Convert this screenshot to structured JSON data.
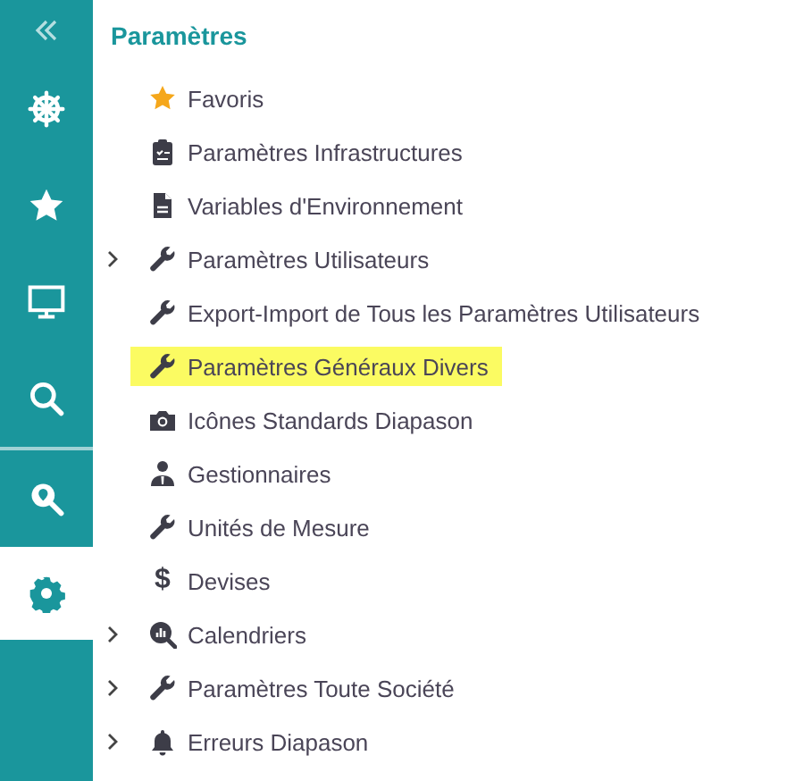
{
  "sidebar": {
    "items": [
      {
        "kind": "wheel",
        "selected": false
      },
      {
        "kind": "star",
        "selected": false
      },
      {
        "kind": "monitor",
        "selected": false
      },
      {
        "kind": "search",
        "selected": false
      },
      {
        "kind": "search-pin",
        "selected": false
      },
      {
        "kind": "gear",
        "selected": true
      }
    ]
  },
  "panel": {
    "title": "Paramètres",
    "items": [
      {
        "label": "Favoris",
        "kind": "star",
        "expandable": false,
        "selected": false
      },
      {
        "label": "Paramètres Infrastructures",
        "kind": "clipboard",
        "expandable": false,
        "selected": false
      },
      {
        "label": "Variables d'Environnement",
        "kind": "file",
        "expandable": false,
        "selected": false
      },
      {
        "label": "Paramètres Utilisateurs",
        "kind": "wrench",
        "expandable": true,
        "selected": false
      },
      {
        "label": "Export-Import de Tous les Paramètres Utilisateurs",
        "kind": "wrench",
        "expandable": false,
        "selected": false
      },
      {
        "label": "Paramètres Généraux Divers",
        "kind": "wrench",
        "expandable": false,
        "selected": true
      },
      {
        "label": "Icônes Standards Diapason",
        "kind": "camera",
        "expandable": false,
        "selected": false
      },
      {
        "label": "Gestionnaires",
        "kind": "person",
        "expandable": false,
        "selected": false
      },
      {
        "label": "Unités de Mesure",
        "kind": "wrench",
        "expandable": false,
        "selected": false
      },
      {
        "label": "Devises",
        "kind": "glyph",
        "glyph": "$",
        "expandable": false,
        "selected": false
      },
      {
        "label": "Calendriers",
        "kind": "chart",
        "expandable": true,
        "selected": false
      },
      {
        "label": "Paramètres Toute Société",
        "kind": "wrench",
        "expandable": true,
        "selected": false
      },
      {
        "label": "Erreurs Diapason",
        "kind": "bell",
        "expandable": true,
        "selected": false
      }
    ]
  }
}
